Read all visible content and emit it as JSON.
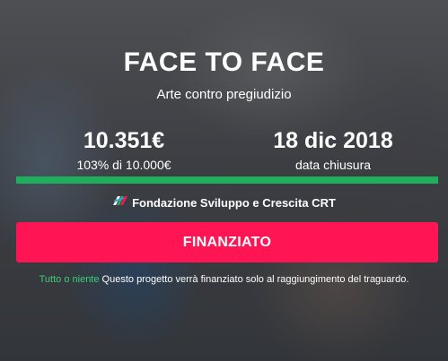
{
  "project": {
    "title": "FACE TO FACE",
    "subtitle": "Arte contro pregiudizio"
  },
  "stats": {
    "amount": "10.351€",
    "amount_label": "103% di 10.000€",
    "date": "18 dic 2018",
    "date_label": "data chiusura"
  },
  "progress": {
    "percent": 103,
    "color": "#1fae5c"
  },
  "sponsor": {
    "name": "Fondazione Sviluppo e Crescita CRT",
    "logo_icon": "crt-logo-icon"
  },
  "action": {
    "button_label": "FINANZIATO",
    "button_color": "#ff1454"
  },
  "note": {
    "highlight": "Tutto o niente",
    "text": "Questo progetto verrà finanziato solo al raggiungimento del traguardo.",
    "highlight_color": "#3bcf73"
  }
}
